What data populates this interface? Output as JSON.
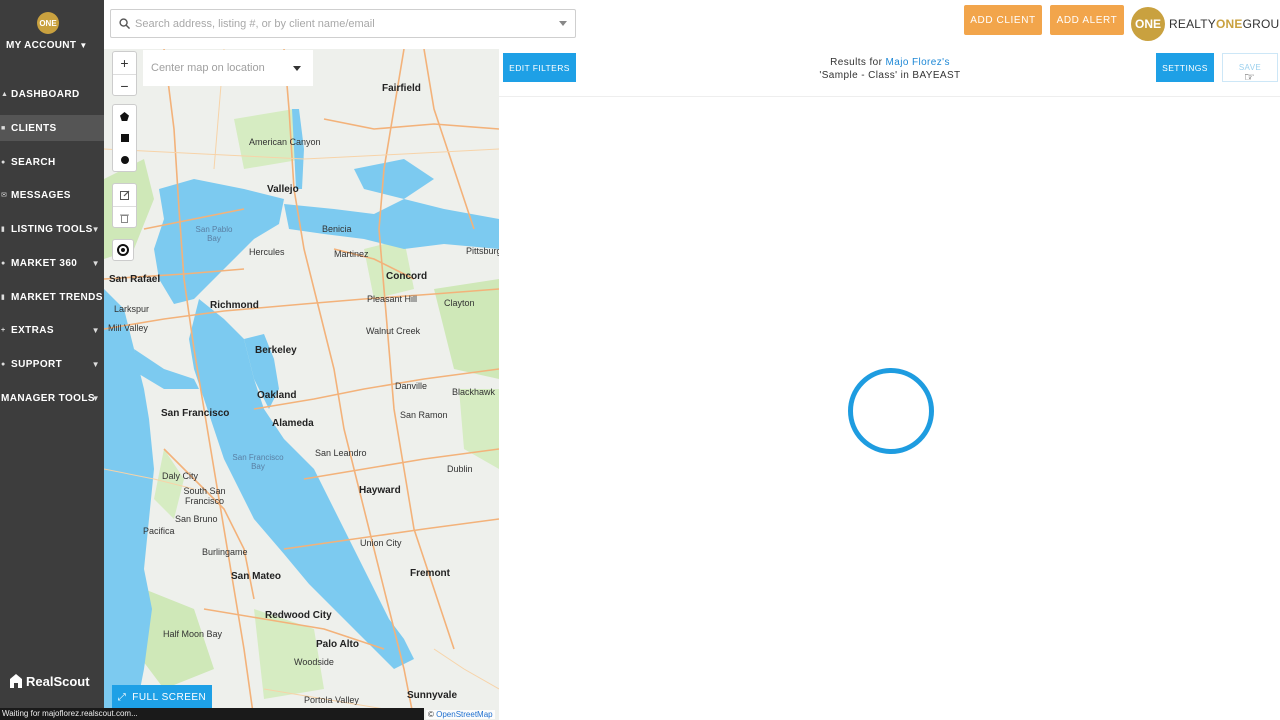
{
  "sidebar": {
    "logo_text": "ONE",
    "account_label": "MY ACCOUNT",
    "items": [
      {
        "label": "DASHBOARD",
        "icon": "home-icon",
        "has_chevron": false,
        "active": false
      },
      {
        "label": "CLIENTS",
        "icon": "clients-icon",
        "has_chevron": false,
        "active": true
      },
      {
        "label": "SEARCH",
        "icon": "pin-icon",
        "has_chevron": false,
        "active": false
      },
      {
        "label": "MESSAGES",
        "icon": "envelope-icon",
        "has_chevron": false,
        "active": false
      },
      {
        "label": "LISTING TOOLS",
        "icon": "bar-chart-icon",
        "has_chevron": true,
        "active": false
      },
      {
        "label": "MARKET 360",
        "icon": "circle-icon",
        "has_chevron": true,
        "active": false
      },
      {
        "label": "MARKET TRENDS",
        "icon": "bar-chart-icon",
        "has_chevron": false,
        "active": false
      },
      {
        "label": "EXTRAS",
        "icon": "plus-icon",
        "has_chevron": true,
        "active": false
      },
      {
        "label": "SUPPORT",
        "icon": "question-icon",
        "has_chevron": true,
        "active": false
      },
      {
        "label": "MANAGER TOOLS",
        "icon": "none",
        "has_chevron": true,
        "active": false
      }
    ],
    "footer_brand": "RealScout"
  },
  "topbar": {
    "search_placeholder": "Search address, listing #, or by client name/email",
    "add_client_label": "ADD CLIENT",
    "add_alert_label": "ADD ALERT",
    "brand_badge": "ONE",
    "brand_prefix": "REALTY",
    "brand_one": "ONE",
    "brand_suffix": "GROUP"
  },
  "map": {
    "center_placeholder": "Center map on location",
    "zoom_in": "+",
    "zoom_out": "−",
    "fullscreen_label": "FULL SCREEN",
    "attribution_prefix": "© ",
    "attribution_link": "OpenStreetMap",
    "places": {
      "fairfield": "Fairfield",
      "american_canyon": "American Canyon",
      "vallejo": "Vallejo",
      "san_pablo_bay": "San Pablo Bay",
      "hercules": "Hercules",
      "benicia": "Benicia",
      "martinez": "Martinez",
      "pittsburg": "Pittsburg",
      "concord": "Concord",
      "san_rafael": "San Rafael",
      "richmond": "Richmond",
      "pleasant_hill": "Pleasant Hill",
      "clayton": "Clayton",
      "larkspur": "Larkspur",
      "mill_valley": "Mill Valley",
      "walnut_creek": "Walnut Creek",
      "berkeley": "Berkeley",
      "oakland": "Oakland",
      "danville": "Danville",
      "blackhawk": "Blackhawk",
      "san_francisco": "San Francisco",
      "alameda": "Alameda",
      "san_ramon": "San Ramon",
      "sf_bay": "San Francisco Bay",
      "daly_city": "Daly City",
      "san_leandro": "San Leandro",
      "dublin": "Dublin",
      "hayward": "Hayward",
      "south_sf": "South San Francisco",
      "san_bruno": "San Bruno",
      "pacifica": "Pacifica",
      "union_city": "Union City",
      "burlingame": "Burlingame",
      "fremont": "Fremont",
      "san_mateo": "San Mateo",
      "redwood_city": "Redwood City",
      "half_moon_bay": "Half Moon Bay",
      "palo_alto": "Palo Alto",
      "woodside": "Woodside",
      "portola_valley": "Portola Valley",
      "sunnyvale": "Sunnyvale"
    }
  },
  "results": {
    "edit_filters_label": "EDIT FILTERS",
    "results_prefix": "Results for ",
    "client_name": "Majo Florez's",
    "search_name": "'Sample - Class' in BAYEAST",
    "settings_label": "SETTINGS",
    "save_label": "SAVE"
  },
  "status_bar": "Waiting for majoflorez.realscout.com...",
  "colors": {
    "sidebar_bg": "#3d3d3d",
    "accent_blue": "#1ea0e6",
    "accent_orange": "#f2a54b",
    "brand_gold": "#c9a13f",
    "water": "#7ccaf0",
    "land": "#eef0ec"
  }
}
